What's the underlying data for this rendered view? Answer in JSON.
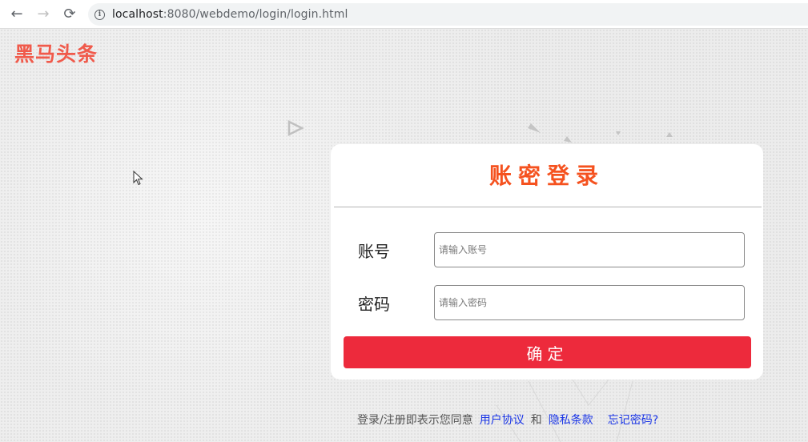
{
  "browser": {
    "url_host": "localhost",
    "url_rest": ":8080/webdemo/login/login.html",
    "back_glyph": "←",
    "forward_glyph": "→",
    "reload_glyph": "⟳"
  },
  "site": {
    "logo": "黑马头条"
  },
  "login": {
    "title": "账密登录",
    "account_label": "账号",
    "account_placeholder": "请输入账号",
    "account_value": "",
    "password_label": "密码",
    "password_placeholder": "请输入密码",
    "password_value": "",
    "submit_label": "确定"
  },
  "footer": {
    "agree_text": "登录/注册即表示您同意",
    "user_agreement": "用户协议",
    "and_text": "和",
    "privacy_policy": "隐私条款",
    "forgot_password": "忘记密码?"
  },
  "colors": {
    "brand": "#f05a4b",
    "title": "#f5521f",
    "button": "#ed2a3c",
    "link": "#1a35e6"
  }
}
